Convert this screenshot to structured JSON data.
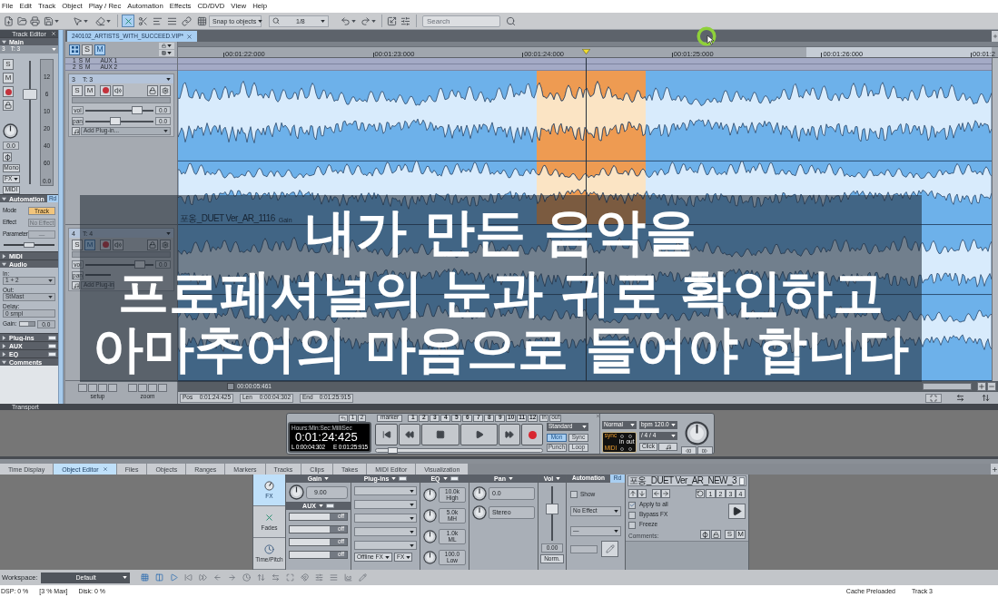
{
  "menu": [
    "File",
    "Edit",
    "Track",
    "Object",
    "Play / Rec",
    "Automation",
    "Effects",
    "CD/DVD",
    "View",
    "Help"
  ],
  "toolbar": {
    "snap": "Snap to objects",
    "zoom": "1/8",
    "search": {
      "placeholder": "Search"
    }
  },
  "track_editor": {
    "title": "Track Editor",
    "sections": [
      {
        "kind": "main",
        "label": "Main",
        "expanded": true,
        "track_number": "3",
        "track_name": "T: 3",
        "buttons": [
          {
            "label": "S",
            "on": false
          },
          {
            "label": "M",
            "on": false
          }
        ],
        "pan_value": "0.0",
        "fader": {
          "level": 0.75
        },
        "meter_scale": [
          "12",
          "6",
          "10",
          "20",
          "40",
          "60"
        ],
        "meter_value": "0.0",
        "options": [
          {
            "kind": "button",
            "label": "Mono"
          },
          {
            "kind": "dropdown",
            "label": "FX"
          },
          {
            "kind": "button",
            "label": "MIDI"
          }
        ]
      },
      {
        "kind": "automation",
        "label": "Automation",
        "expanded": true,
        "read": "Rd",
        "rows": [
          {
            "kind": "mode",
            "label": "Mode",
            "value": "Track",
            "disabled": false
          },
          {
            "kind": "field",
            "label": "Effect",
            "value": "No Effect",
            "disabled": true
          },
          {
            "kind": "field",
            "label": "Parameter",
            "value": "—",
            "disabled": true
          }
        ],
        "slider": {
          "level": 0.5
        }
      },
      {
        "kind": "midi",
        "label": "MIDI",
        "expanded": false
      },
      {
        "kind": "audio",
        "label": "Audio",
        "expanded": true,
        "fields": [
          {
            "kind": "dropdown",
            "label": "In:",
            "value": "1 + 2"
          },
          {
            "kind": "dropdown",
            "label": "Out:",
            "value": "StMast"
          },
          {
            "kind": "field",
            "label": "Delay:",
            "value": "0 smpl"
          }
        ],
        "gain": {
          "label": "Gain:",
          "value": "0.0",
          "level": 0.6
        }
      },
      {
        "kind": "plugins",
        "label": "Plug-ins",
        "expanded": false
      },
      {
        "kind": "aux",
        "label": "AUX",
        "expanded": false
      },
      {
        "kind": "eq",
        "label": "EQ",
        "expanded": false
      },
      {
        "kind": "comments",
        "label": "Comments",
        "expanded": true
      }
    ]
  },
  "project": {
    "tab": "240102_ARTISTS_WITH_SUCCEED.VIP*",
    "header_buttons": [
      {
        "label": "S",
        "on": false
      },
      {
        "label": "M",
        "on": true
      }
    ],
    "aux_tracks": [
      {
        "number": "1",
        "name": "AUX 1",
        "buttons": [
          "S",
          "M"
        ]
      },
      {
        "number": "2",
        "name": "AUX 2",
        "buttons": [
          "S",
          "M"
        ]
      }
    ],
    "tracks": [
      {
        "number": "3",
        "name": "T: 3",
        "buttons": [
          {
            "label": "S",
            "on": false
          },
          {
            "label": "M",
            "on": false
          }
        ],
        "vol": {
          "label": "vol",
          "value": "0.0",
          "level": 0.76
        },
        "pan": {
          "label": "pan",
          "value": "0.0",
          "level": 0.44
        },
        "plugin": "Add Plug-in..."
      },
      {
        "number": "4",
        "name": "T: 4",
        "buttons": [
          {
            "label": "S",
            "on": false
          },
          {
            "label": "M",
            "on": true
          }
        ],
        "vol": {
          "label": "vol",
          "value": "0.0",
          "level": 0.8
        },
        "pan": {
          "label": "pan"
        },
        "plugin": "Add Plug-in"
      }
    ],
    "ruler": [
      "00:01:22:000",
      "00:01:23:000",
      "00:01:24:000",
      "00:01:25:000",
      "00:01:26:000",
      "00:01:2"
    ],
    "objects": [
      {
        "name": "포옹_DUET Ver_AR_1116",
        "param": "Gain"
      }
    ],
    "footer": {
      "groups": [
        "setup",
        "zoom"
      ],
      "length": "00:00:05:461",
      "fields": [
        {
          "label": "Pos",
          "value": "0:01:24:425"
        },
        {
          "label": "Len",
          "value": "0:00:04:302"
        },
        {
          "label": "End",
          "value": "0:01:25:915"
        }
      ]
    }
  },
  "subtitle": [
    "내가 만든 음악을",
    "프로페셔널의 눈과 귀로 확인하고",
    "아마추어의 마음으로 들어야 합니다"
  ],
  "transport": {
    "title": "Transport",
    "markers": {
      "back": [
        "1",
        "2"
      ],
      "label": "marker",
      "numbers": [
        "1",
        "2",
        "3",
        "4",
        "5",
        "6",
        "7",
        "8",
        "9",
        "10",
        "11",
        "12"
      ],
      "in": "in",
      "out": "out"
    },
    "display": {
      "format": "Hours:Min:Sec:MilliSec",
      "time": "0:01:24:425",
      "length": "L 0:00:04:302",
      "end": "E 0:01:25:915"
    },
    "position": {
      "level": 0.07
    },
    "mode": "Standard",
    "toggles": [
      {
        "label": "Mon",
        "on": true
      },
      {
        "label": "Sync",
        "on": false
      },
      {
        "label": "Punch",
        "on": false
      },
      {
        "label": "Loop",
        "on": false
      }
    ],
    "speed": "Normal",
    "sync": {
      "sync": "sync",
      "midi": "MIDI",
      "in": "in",
      "out": "out"
    },
    "tempo": "bpm 120.0",
    "signature": "/ 4 / 4",
    "click": "Click"
  },
  "bottom_tabs": [
    {
      "label": "Time Display",
      "selected": false
    },
    {
      "label": "Object Editor",
      "selected": true
    },
    {
      "label": "Files",
      "selected": false
    },
    {
      "label": "Objects",
      "selected": false
    },
    {
      "label": "Ranges",
      "selected": false
    },
    {
      "label": "Markers",
      "selected": false
    },
    {
      "label": "Tracks",
      "selected": false
    },
    {
      "label": "Clips",
      "selected": false
    },
    {
      "label": "Takes",
      "selected": false
    },
    {
      "label": "MIDI Editor",
      "selected": false
    },
    {
      "label": "Visualization",
      "selected": false
    }
  ],
  "object_editor": {
    "side_tabs": [
      {
        "label": "FX",
        "selected": true
      },
      {
        "label": "Fades",
        "selected": false
      },
      {
        "label": "Time/Pitch",
        "selected": false
      }
    ],
    "gain": {
      "title": "Gain",
      "value": "9.00"
    },
    "aux": {
      "title": "AUX",
      "sends": [
        {
          "value": "off",
          "level": 0.7
        },
        {
          "value": "off",
          "level": 0.7
        },
        {
          "value": "off",
          "level": 0.7
        },
        {
          "value": "off",
          "level": 0.7
        }
      ]
    },
    "plugins": {
      "title": "Plug-ins",
      "offline": "Offline FX",
      "fx": "FX"
    },
    "eq": {
      "title": "EQ",
      "bands": [
        {
          "value": "10.0k",
          "label": "High"
        },
        {
          "value": "5.0k",
          "label": "MH"
        },
        {
          "value": "1.0k",
          "label": "ML"
        },
        {
          "value": "100.0",
          "label": "Low"
        }
      ]
    },
    "pan": {
      "title": "Pan",
      "values": [
        "0.0",
        "Stereo"
      ]
    },
    "vol": {
      "title": "Vol",
      "value": "0.00",
      "button": "Norm.",
      "level": 0.6
    },
    "automation": {
      "title": "Automation",
      "read": "Rd",
      "show": {
        "label": "Show",
        "checked": false
      },
      "effect": "No Effect",
      "parameter": "—"
    },
    "object": {
      "name": "포옹_DUET Ver_AR_NEW_3",
      "takes": [
        "1",
        "2",
        "3",
        "4"
      ],
      "options": [
        {
          "label": "Apply to all",
          "checked": true
        },
        {
          "label": "Bypass FX",
          "checked": false
        },
        {
          "label": "Freeze",
          "checked": false
        }
      ],
      "comments": "Comments:",
      "buttons": [
        "S",
        "M"
      ]
    }
  },
  "workspace": {
    "label": "Workspace:",
    "value": "Default"
  },
  "status_bar": {
    "left": [
      "DSP: 0 %",
      "[3 % Max]",
      "Disk: 0 %"
    ],
    "right": [
      "Cache Preloaded",
      "Track 3"
    ]
  }
}
